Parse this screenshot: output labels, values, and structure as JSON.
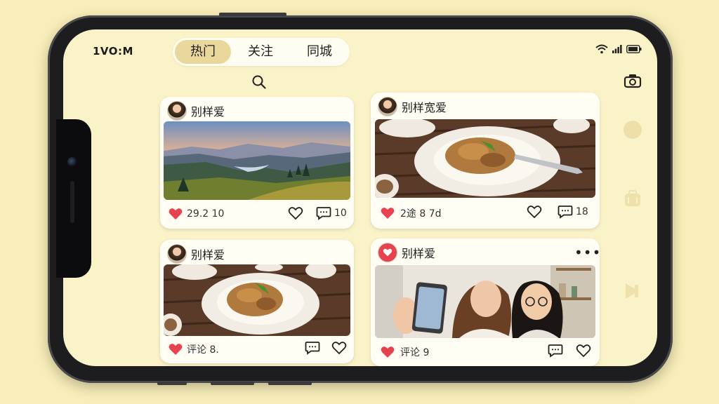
{
  "status_bar": {
    "time": "1VO:M"
  },
  "tabs": [
    {
      "label": "热门",
      "active": true
    },
    {
      "label": "关注",
      "active": false
    },
    {
      "label": "同城",
      "active": false
    }
  ],
  "icons": {
    "search": "search-icon",
    "camera": "camera-icon",
    "wifi": "wifi-icon",
    "signal": "signal-icon",
    "battery": "battery-icon"
  },
  "colors": {
    "background": "#f8eeb9",
    "screen": "#fbf3c8",
    "accent": "#e8424f",
    "tab_active": "#ead79c"
  },
  "posts": [
    {
      "username": "别样爱",
      "stats_text": "29.2 10",
      "comments": "10",
      "media": "mountain landscape at sunset"
    },
    {
      "username": "别样宽爱",
      "stats_text": "2途 8 7d",
      "comments": "18",
      "media": "plate of braised meat on wooden table"
    },
    {
      "username": "别样爱",
      "stats_text": "评论 8.",
      "media": "plate of braised meat on wooden table"
    },
    {
      "username": "别样爱",
      "stats_text": "评论 9",
      "more": "•••",
      "media": "two women taking a selfie"
    }
  ]
}
